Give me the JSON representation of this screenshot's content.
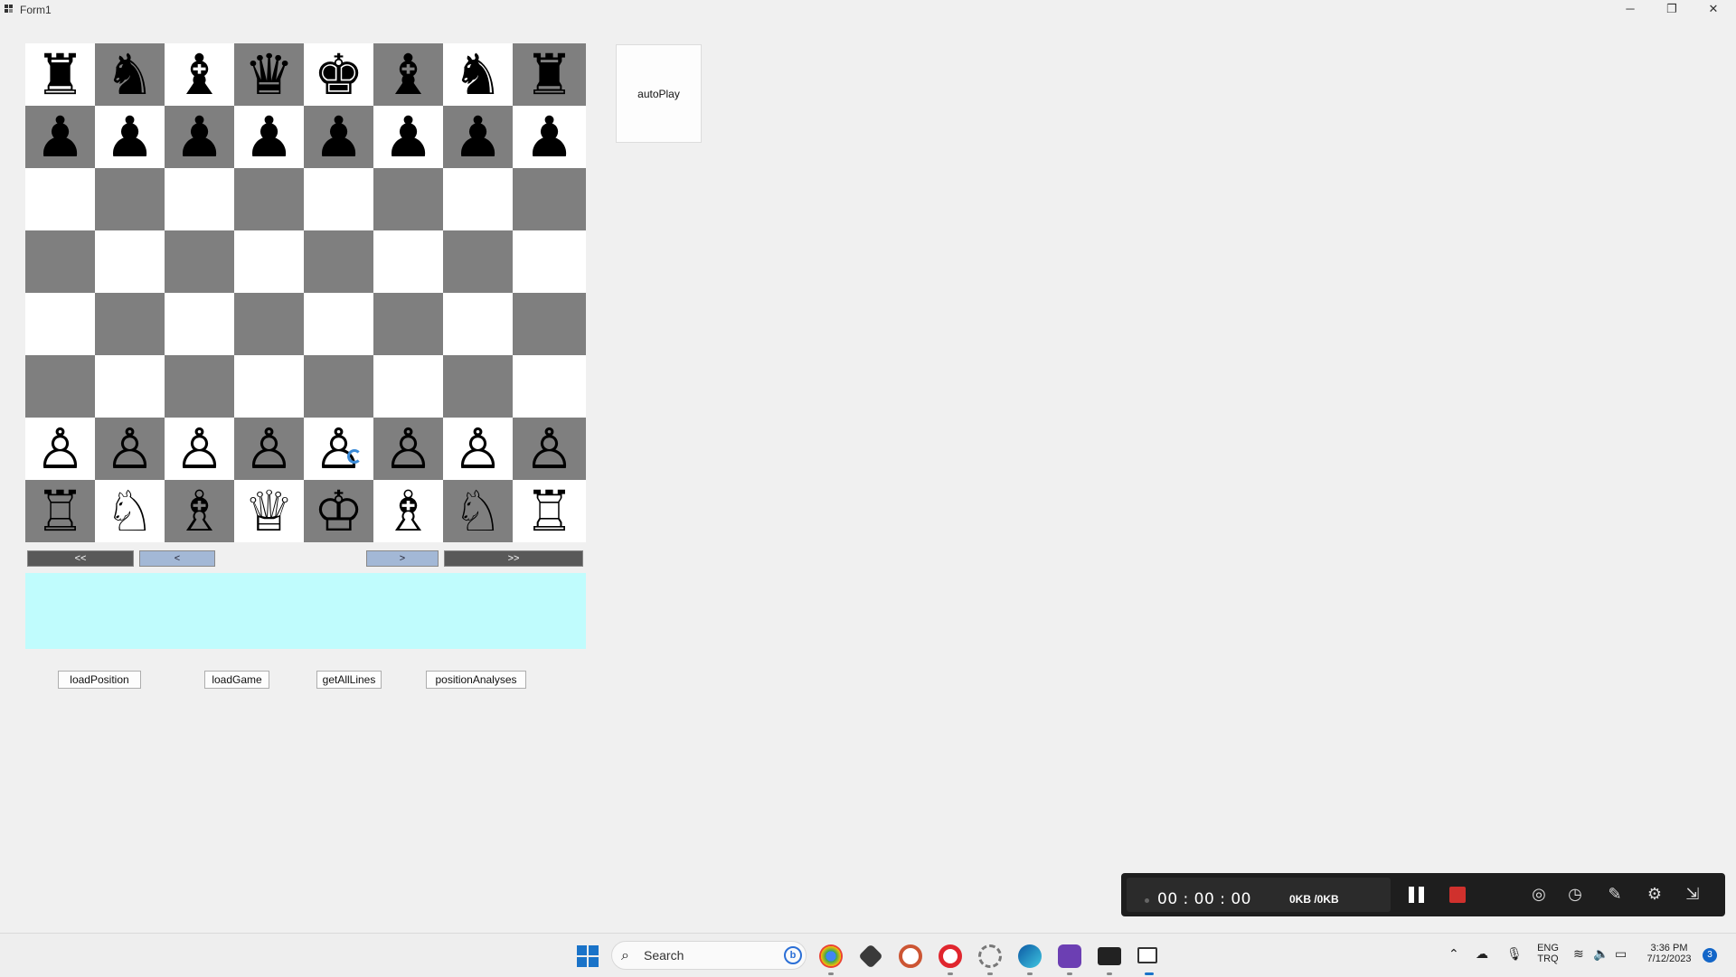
{
  "window": {
    "title": "Form1",
    "minimize_glyph": "─",
    "maximize_glyph": "❐",
    "close_glyph": "✕"
  },
  "board": {
    "light_color": "#ffffff",
    "dark_color": "#7f7f7f",
    "ranks": [
      [
        "♜",
        "♞",
        "♝",
        "♛",
        "♚",
        "♝",
        "♞",
        "♜"
      ],
      [
        "♟",
        "♟",
        "♟",
        "♟",
        "♟",
        "♟",
        "♟",
        "♟"
      ],
      [
        "",
        "",
        "",
        "",
        "",
        "",
        "",
        ""
      ],
      [
        "",
        "",
        "",
        "",
        "",
        "",
        "",
        ""
      ],
      [
        "",
        "",
        "",
        "",
        "",
        "",
        "",
        ""
      ],
      [
        "",
        "",
        "",
        "",
        "",
        "",
        "",
        ""
      ],
      [
        "♙",
        "♙",
        "♙",
        "♙",
        "♙",
        "♙",
        "♙",
        "♙"
      ],
      [
        "♖",
        "♘",
        "♗",
        "♕",
        "♔",
        "♗",
        "♘",
        "♖"
      ]
    ]
  },
  "navigation": {
    "first_label": "<<",
    "prev_label": "<",
    "next_label": ">",
    "last_label": ">>"
  },
  "buttons": {
    "autoplay": "autoPlay",
    "load_position": "loadPosition",
    "load_game": "loadGame",
    "get_all_lines": "getAllLines",
    "position_analyses": "positionAnalyses"
  },
  "recorder": {
    "time": "00 : 00 : 00",
    "size": "0KB /0KB",
    "stop_color": "#d0312d"
  },
  "taskbar": {
    "search_placeholder": "Search",
    "language_line1": "ENG",
    "language_line2": "TRQ",
    "time": "3:36 PM",
    "date": "7/12/2023",
    "notification_count": "3"
  }
}
